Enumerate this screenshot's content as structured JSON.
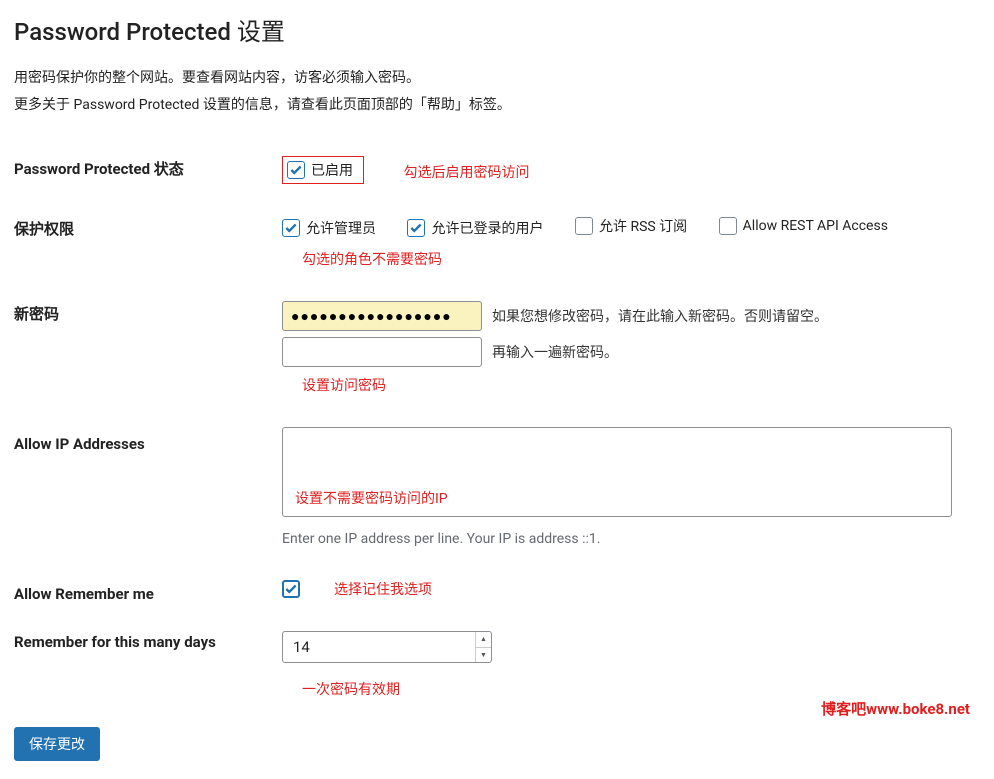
{
  "title": "Password Protected 设置",
  "description_line1": "用密码保护你的整个网站。要查看网站内容，访客必须输入密码。",
  "description_line2": "更多关于 Password Protected 设置的信息，请查看此页面顶部的「帮助」标签。",
  "status": {
    "label": "Password Protected 状态",
    "checkbox_label": "已启用",
    "checked": "true",
    "note": "勾选后启用密码访问"
  },
  "permissions": {
    "label": "保护权限",
    "options": [
      {
        "label": "允许管理员",
        "checked": "true"
      },
      {
        "label": "允许已登录的用户",
        "checked": "true"
      },
      {
        "label": "允许 RSS 订阅",
        "checked": "false"
      },
      {
        "label": "Allow REST API Access",
        "checked": "false"
      }
    ],
    "note": "勾选的角色不需要密码"
  },
  "new_password": {
    "label": "新密码",
    "masked_value": "●●●●●●●●●●●●●●●●●",
    "hint1": "如果您想修改密码，请在此输入新密码。否则请留空。",
    "confirm_value": "",
    "hint2": "再输入一遍新密码。",
    "note": "设置访问密码"
  },
  "allow_ip": {
    "label": "Allow IP Addresses",
    "value": "",
    "inner_note": "设置不需要密码访问的IP",
    "hint": "Enter one IP address per line. Your IP is address ::1."
  },
  "remember_me": {
    "label": "Allow Remember me",
    "checked": "true",
    "note": "选择记住我选项"
  },
  "remember_days": {
    "label": "Remember for this many days",
    "value": "14",
    "note": "一次密码有效期"
  },
  "submit_label": "保存更改",
  "watermark": "博客吧www.boke8.net"
}
